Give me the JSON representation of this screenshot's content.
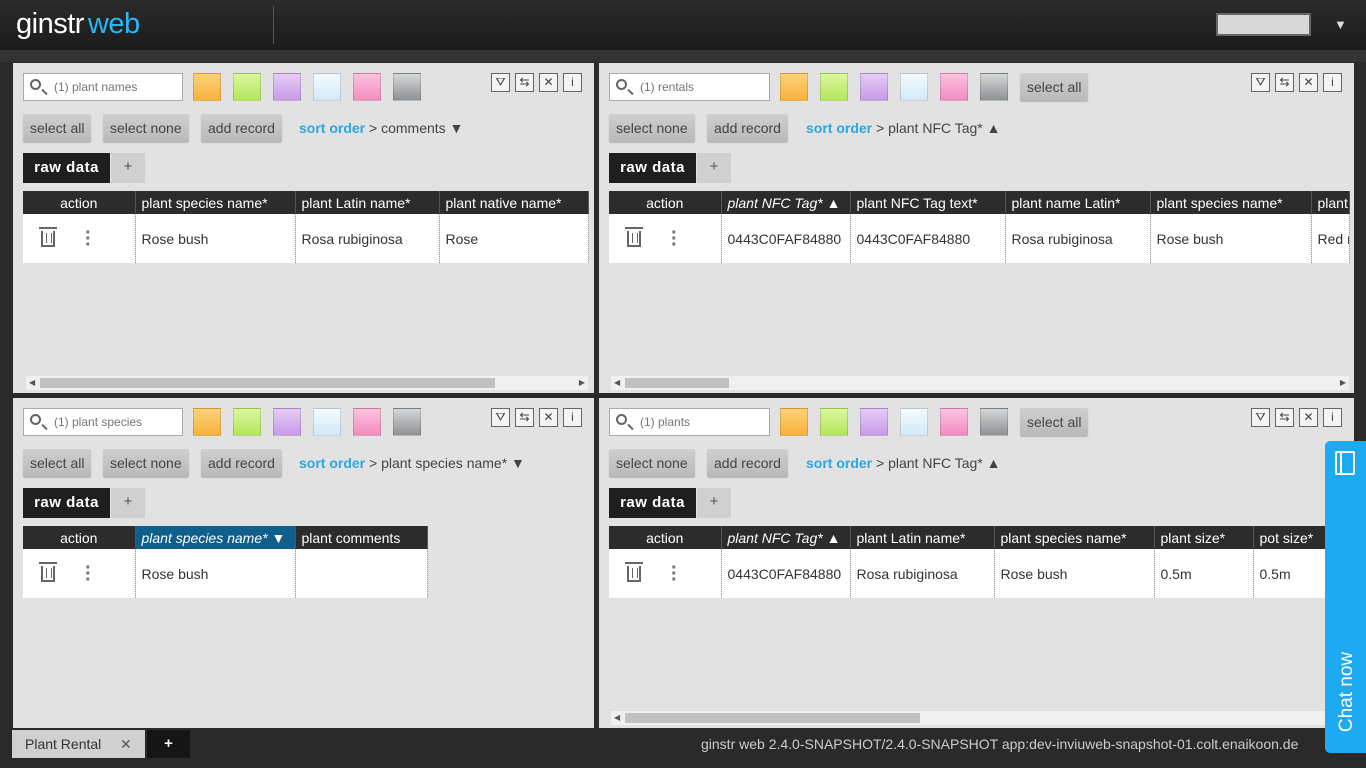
{
  "app": {
    "logo_main": "ginstr",
    "logo_sub": "web"
  },
  "colors": {
    "accent": "#29a8e0",
    "chat": "#1eaaf1"
  },
  "swatches": [
    "#fdc35a",
    "#c9f07a",
    "#d8b3ef",
    "#e3f1fb",
    "#f7a6cf",
    "#a5a9ab"
  ],
  "buttons": {
    "select_all": "select all",
    "select_none": "select none",
    "add_record": "add record"
  },
  "tabs": {
    "raw": "raw data",
    "plus": "+"
  },
  "tools": {
    "filter": "filter-icon",
    "swap": "swap-icon",
    "clear": "clear-icon",
    "info": "info-icon"
  },
  "panels": {
    "p1": {
      "search_placeholder": "(1) plant names",
      "sort_label": "sort order",
      "sort_value": "> comments",
      "sort_dir": "▼",
      "columns": [
        "action",
        "plant species name*",
        "plant Latin name*",
        "plant native name*"
      ],
      "rows": [
        [
          "Rose bush",
          "Rosa rubiginosa",
          "Rose"
        ]
      ]
    },
    "p2": {
      "search_placeholder": "(1) rentals",
      "sort_label": "sort order",
      "sort_value": "> plant NFC Tag*",
      "sort_dir": "▲",
      "columns": [
        "action",
        "plant NFC Tag* ▲",
        "plant NFC Tag text*",
        "plant name Latin*",
        "plant species name*",
        "plant"
      ],
      "rows": [
        [
          "0443C0FAF84880",
          "0443C0FAF84880",
          "Rosa rubiginosa",
          "Rose bush",
          "Red r"
        ]
      ]
    },
    "p3": {
      "search_placeholder": "(1) plant species",
      "sort_label": "sort order",
      "sort_value": "> plant species name*",
      "sort_dir": "▼",
      "columns": [
        "action",
        "plant species name* ▼",
        "plant comments"
      ],
      "rows": [
        [
          "Rose bush",
          ""
        ]
      ]
    },
    "p4": {
      "search_placeholder": "(1) plants",
      "sort_label": "sort order",
      "sort_value": "> plant NFC Tag*",
      "sort_dir": "▲",
      "columns": [
        "action",
        "plant NFC Tag* ▲",
        "plant Latin name*",
        "plant species name*",
        "plant size*",
        "pot size*"
      ],
      "rows": [
        [
          "0443C0FAF84880",
          "Rosa rubiginosa",
          "Rose bush",
          "0.5m",
          "0.5m"
        ]
      ]
    }
  },
  "footer": {
    "tab_label": "Plant Rental",
    "tab_close": "✕",
    "add_tab": "+",
    "version": "ginstr web 2.4.0-SNAPSHOT/2.4.0-SNAPSHOT app:dev-inviuweb-snapshot-01.colt.enaikoon.de"
  },
  "chat": {
    "label": "Chat now"
  }
}
